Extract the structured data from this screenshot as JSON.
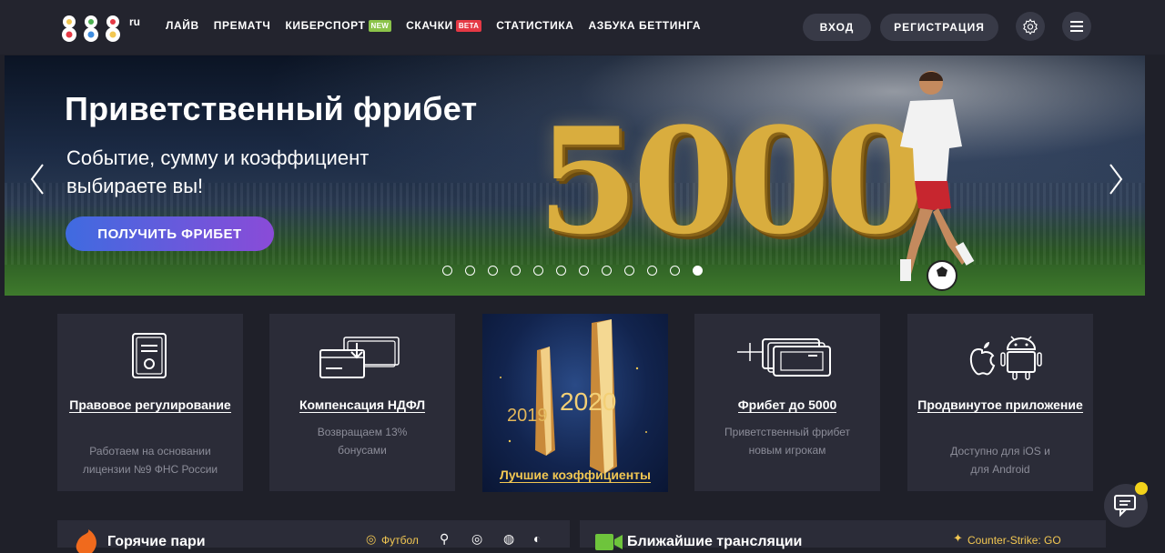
{
  "header": {
    "logo_text": "888",
    "logo_suffix": "ru",
    "nav": [
      {
        "label": "ЛАЙВ"
      },
      {
        "label": "ПРЕМАТЧ"
      },
      {
        "label": "КИБЕРСПОРТ",
        "badge": "NEW"
      },
      {
        "label": "СКАЧКИ",
        "badge": "BETA"
      },
      {
        "label": "СТАТИСТИКА"
      },
      {
        "label": "АЗБУКА БЕТТИНГА"
      }
    ],
    "login_label": "ВХОД",
    "register_label": "РЕГИСТРАЦИЯ",
    "settings_icon": "gear-icon",
    "menu_icon": "hamburger-icon"
  },
  "hero": {
    "title": "Приветственный фрибет",
    "subtitle": "Событие, сумму и коэффициент выбираете вы!",
    "cta_label": "ПОЛУЧИТЬ ФРИБЕТ",
    "big_number": "5000",
    "slide_count": 12,
    "active_slide": 12
  },
  "cards": [
    {
      "title": "Правовое регулирование",
      "desc": "Работаем на основании лицензии №9 ФНС России",
      "icon": "document-icon"
    },
    {
      "title": "Компенсация НДФЛ",
      "desc": "Возвращаем 13% бонусами",
      "icon": "payment-card-icon"
    },
    {
      "title": "Фрибет до 5000",
      "desc": "Приветственный фрибет новым игрокам",
      "icon": "tickets-icon"
    },
    {
      "title": "Продвинутое приложение",
      "desc": "Доступно для iOS и для Android",
      "icon": "apple-android-icon"
    }
  ],
  "promo": {
    "year_left": "2019",
    "year_right": "2020",
    "label": "Лучшие коэффициенты"
  },
  "sections": {
    "hot_title": "Горячие пари",
    "hot_tag": "Футбол",
    "live_title": "Ближайшие трансляции",
    "live_tag": "Counter-Strike: GO"
  },
  "colors": {
    "background": "#1f2029",
    "card": "#2b2c38",
    "accent_gold": "#f2c752",
    "badge_new": "#8bc34a",
    "badge_beta": "#e53945"
  }
}
